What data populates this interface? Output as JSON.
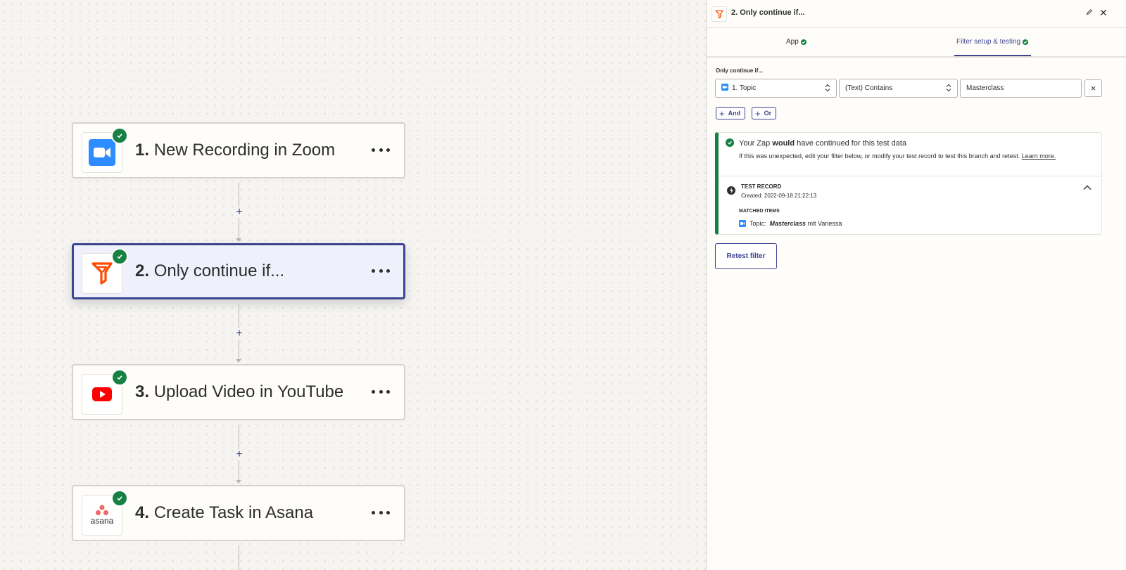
{
  "canvas": {
    "steps": [
      {
        "number": "1.",
        "title": "New Recording in Zoom",
        "app": "zoom-icon"
      },
      {
        "number": "2.",
        "title": "Only continue if...",
        "app": "filter-icon"
      },
      {
        "number": "3.",
        "title": "Upload Video in YouTube",
        "app": "youtube-icon"
      },
      {
        "number": "4.",
        "title": "Create Task in Asana",
        "app": "asana-icon",
        "logo_text": "asana"
      }
    ],
    "add_step_label": "+"
  },
  "panel": {
    "title": "2. Only continue if...",
    "tabs": [
      {
        "label": "App",
        "status": "complete"
      },
      {
        "label": "Filter setup & testing",
        "status": "complete",
        "active": true
      }
    ],
    "filter": {
      "label": "Only continue if...",
      "field": "1. Topic",
      "condition": "(Text) Contains",
      "value": "Masterclass",
      "remove_label": "×",
      "and_label": "And",
      "or_label": "Or"
    },
    "result": {
      "title_prefix": "Your Zap ",
      "title_bold": "would",
      "title_suffix": " have continued for this test data",
      "description": "If this was unexpected, edit your filter below, or modify your test record to test this branch and retest. ",
      "learn_more": "Learn more.",
      "record_title": "TEST RECORD",
      "record_created": "Created: 2022-09-18 21:22:13",
      "matched_label": "MATCHED ITEMS",
      "matched_key": "Topic:",
      "matched_highlight": "Masterclass",
      "matched_rest": " mit Vanessa"
    },
    "retest_label": "Retest filter"
  },
  "colors": {
    "accent": "#3d4592",
    "success": "#178144",
    "filter_orange": "#ff4a00",
    "zoom_blue": "#2d8cff",
    "youtube_red": "#ff0000",
    "asana_coral": "#f06a6a"
  }
}
